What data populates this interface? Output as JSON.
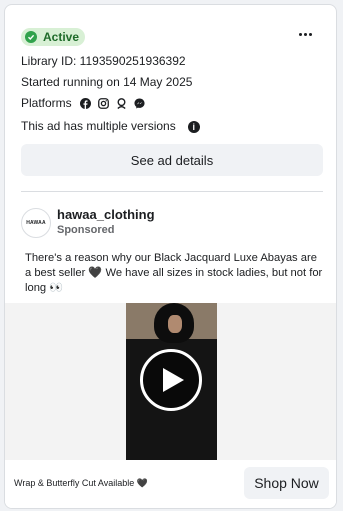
{
  "status": {
    "label": "Active",
    "color": "#31a24c"
  },
  "library_id": "Library ID: 1193590251936392",
  "started": "Started running on 14 May 2025",
  "platforms": {
    "label": "Platforms",
    "icons": [
      "facebook-icon",
      "instagram-icon",
      "audience-network-icon",
      "messenger-icon"
    ]
  },
  "versions_note": "This ad has multiple versions",
  "details_button": "See ad details",
  "advertiser": {
    "name": "hawaa_clothing",
    "avatar_text": "HAWAA",
    "sponsored": "Sponsored"
  },
  "ad_text": "There's a reason why our Black Jacquard Luxe Abayas are a best seller 🖤 We have all sizes in stock ladies, but not for long 👀",
  "footer": {
    "caption": "Wrap & Butterfly Cut Available 🖤",
    "cta": "Shop Now"
  }
}
